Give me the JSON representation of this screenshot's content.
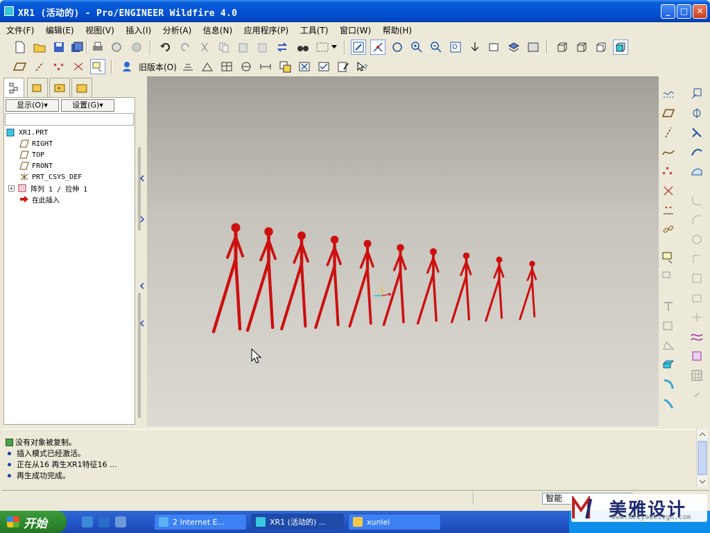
{
  "window": {
    "title": "XR1 (活动的) - Pro/ENGINEER Wildfire 4.0",
    "minimize": "_",
    "maximize": "□",
    "close": "✕"
  },
  "menu": [
    "文件(F)",
    "编辑(E)",
    "视图(V)",
    "插入(I)",
    "分析(A)",
    "信息(N)",
    "应用程序(P)",
    "工具(T)",
    "窗口(W)",
    "帮助(H)"
  ],
  "toolbar2": {
    "legacy_label": "旧版本(O)"
  },
  "navigator": {
    "show_button": "显示(O)▾",
    "settings_button": "设置(G)▾",
    "tree": [
      {
        "label": "XR1.PRT",
        "icon": "part-icon"
      },
      {
        "label": "RIGHT",
        "icon": "datum-plane-icon"
      },
      {
        "label": "TOP",
        "icon": "datum-plane-icon"
      },
      {
        "label": "FRONT",
        "icon": "datum-plane-icon"
      },
      {
        "label": "PRT_CSYS_DEF",
        "icon": "csys-icon"
      },
      {
        "label": "阵列 1 / 拉伸 1",
        "icon": "pattern-icon"
      },
      {
        "label": "在此插入",
        "icon": "insert-arrow-icon"
      }
    ]
  },
  "messages": [
    "没有对象被复制。",
    "插入模式已经激活。",
    "正在从16 再生XR1特征16 ...",
    "再生成功完成。"
  ],
  "status": {
    "filter_value": "智能"
  },
  "taskbar": {
    "start_label": "开始",
    "tasks": [
      "2 Internet E...",
      "XR1 (活动的) ...",
      "xunlei"
    ]
  },
  "watermark": {
    "title": "美雅设计",
    "url": "www.meiyadesign.com"
  },
  "colors": {
    "figure_red": "#cc1010",
    "title_blue": "#0453d6",
    "face": "#ece9d8"
  }
}
